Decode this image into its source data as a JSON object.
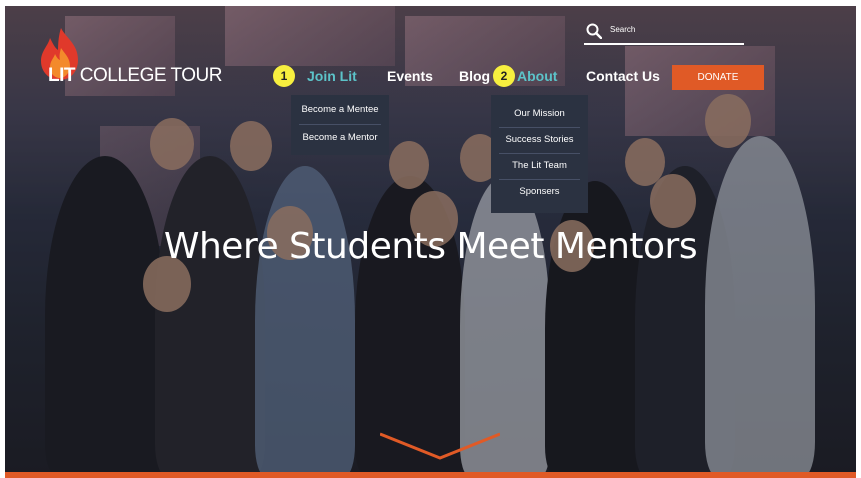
{
  "logo": {
    "word1": "LIT",
    "word2": "COLLEGE TOUR"
  },
  "search": {
    "placeholder": "Search"
  },
  "nav": [
    {
      "label": "Join Lit",
      "active": true
    },
    {
      "label": "Events",
      "active": false
    },
    {
      "label": "Blog",
      "active": false
    },
    {
      "label": "About",
      "active": true
    },
    {
      "label": "Contact Us",
      "active": false
    }
  ],
  "markers": [
    "1",
    "2"
  ],
  "donate": {
    "label": "DONATE"
  },
  "join_dropdown": [
    "Become a Mentee",
    "Become a Mentor"
  ],
  "about_dropdown": [
    "Our Mission",
    "Success Stories",
    "The Lit Team",
    "Sponsers"
  ],
  "hero": {
    "headline": "Where Students Meet Mentors"
  },
  "colors": {
    "accent_orange": "#e05a26",
    "active_teal": "#5cc3c9",
    "marker_yellow": "#f7ef3f",
    "dropdown_bg": "#2b3241"
  }
}
